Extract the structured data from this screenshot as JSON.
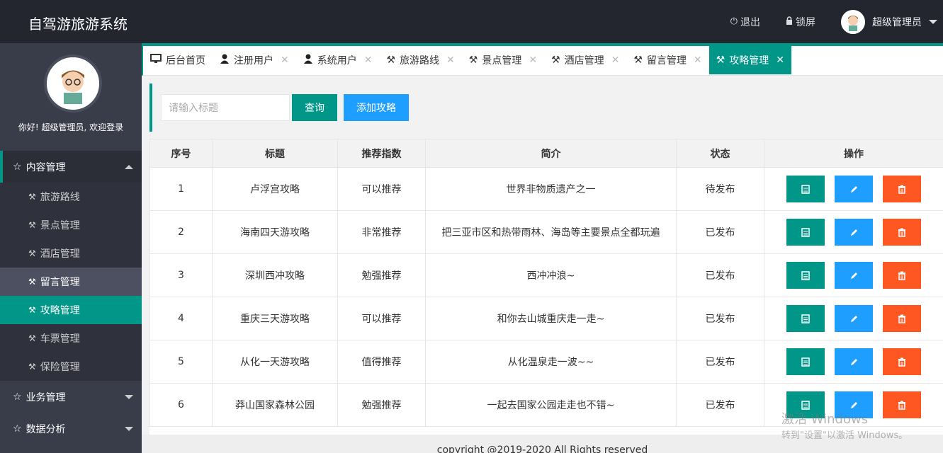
{
  "app": {
    "title": "自驾游旅游系统"
  },
  "header": {
    "logout_label": "退出",
    "lock_label": "锁屏",
    "user_name": "超级管理员"
  },
  "sidebar": {
    "welcome": "你好! 超级管理员, 欢迎登录",
    "groups": [
      {
        "label": "内容管理",
        "expanded": true
      },
      {
        "label": "业务管理",
        "expanded": false
      },
      {
        "label": "数据分析",
        "expanded": false
      }
    ],
    "items": [
      {
        "label": "旅游路线"
      },
      {
        "label": "景点管理"
      },
      {
        "label": "酒店管理"
      },
      {
        "label": "留言管理"
      },
      {
        "label": "攻略管理"
      },
      {
        "label": "车票管理"
      },
      {
        "label": "保险管理"
      }
    ]
  },
  "tabs": [
    {
      "label": "后台首页",
      "icon": "monitor-icon"
    },
    {
      "label": "注册用户",
      "icon": "user-icon"
    },
    {
      "label": "系统用户",
      "icon": "user-icon"
    },
    {
      "label": "旅游路线",
      "icon": "tools-icon"
    },
    {
      "label": "景点管理",
      "icon": "tools-icon"
    },
    {
      "label": "酒店管理",
      "icon": "tools-icon"
    },
    {
      "label": "留言管理",
      "icon": "tools-icon"
    },
    {
      "label": "攻略管理",
      "icon": "tools-icon",
      "active": true
    }
  ],
  "search": {
    "placeholder": "请输入标题",
    "query_label": "查询",
    "add_label": "添加攻略"
  },
  "table": {
    "headers": [
      "序号",
      "标题",
      "推荐指数",
      "简介",
      "状态",
      "操作"
    ],
    "rows": [
      {
        "id": "1",
        "title": "卢浮宫攻略",
        "rating": "可以推荐",
        "intro": "世界非物质遗产之一",
        "status": "待发布"
      },
      {
        "id": "2",
        "title": "海南四天游攻略",
        "rating": "非常推荐",
        "intro": "把三亚市区和热带雨林、海岛等主要景点全都玩遍",
        "status": "已发布"
      },
      {
        "id": "3",
        "title": "深圳西冲攻略",
        "rating": "勉强推荐",
        "intro": "西冲冲浪~",
        "status": "已发布"
      },
      {
        "id": "4",
        "title": "重庆三天游攻略",
        "rating": "可以推荐",
        "intro": "和你去山城重庆走一走~",
        "status": "已发布"
      },
      {
        "id": "5",
        "title": "从化一天游攻略",
        "rating": "值得推荐",
        "intro": "从化温泉走一波~~",
        "status": "已发布"
      },
      {
        "id": "6",
        "title": "莽山国家森林公园",
        "rating": "勉强推荐",
        "intro": "一起去国家公园走走也不错~",
        "status": "已发布"
      }
    ]
  },
  "footer": {
    "text": "copyright @2019-2020 All Rights reserved"
  },
  "watermark": {
    "line1": "激活 Windows",
    "line2": "转到\"设置\"以激活 Windows。"
  },
  "colors": {
    "accent": "#009688",
    "blue": "#1e9fff",
    "danger": "#ff5722",
    "sidebar": "#393d49",
    "topbar": "#23262e"
  }
}
